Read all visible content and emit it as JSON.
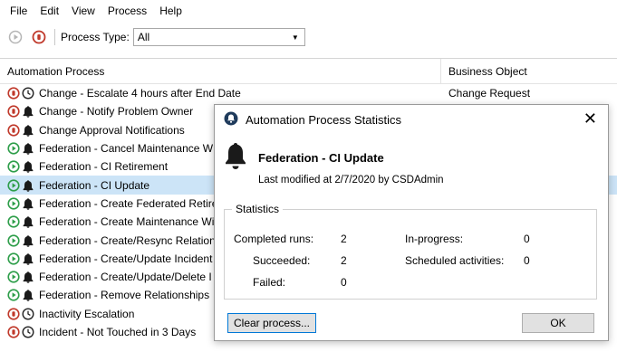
{
  "menu": [
    "File",
    "Edit",
    "View",
    "Process",
    "Help"
  ],
  "toolbar": {
    "process_type_label": "Process Type:",
    "process_type_value": "All"
  },
  "grid": {
    "columns": [
      "Automation Process",
      "Business Object"
    ],
    "rows": [
      {
        "status": "stop",
        "type": "clock",
        "name": "Change - Escalate 4 hours after End Date",
        "object": "Change Request"
      },
      {
        "status": "stop",
        "type": "bell",
        "name": "Change - Notify Problem Owner",
        "object": ""
      },
      {
        "status": "stop",
        "type": "bell",
        "name": "Change Approval Notifications",
        "object": ""
      },
      {
        "status": "play",
        "type": "bell",
        "name": "Federation - Cancel Maintenance W",
        "object": ""
      },
      {
        "status": "play",
        "type": "bell",
        "name": "Federation - CI Retirement",
        "object": ""
      },
      {
        "status": "play",
        "type": "bell",
        "name": "Federation - CI Update",
        "object": "",
        "selected": true
      },
      {
        "status": "play",
        "type": "bell",
        "name": "Federation - Create Federated Retire",
        "object": ""
      },
      {
        "status": "play",
        "type": "bell",
        "name": "Federation - Create Maintenance Wi",
        "object": ""
      },
      {
        "status": "play",
        "type": "bell",
        "name": "Federation - Create/Resync Relation",
        "object": ""
      },
      {
        "status": "play",
        "type": "bell",
        "name": "Federation - Create/Update Incident",
        "object": ""
      },
      {
        "status": "play",
        "type": "bell",
        "name": "Federation - Create/Update/Delete I",
        "object": ""
      },
      {
        "status": "play",
        "type": "bell",
        "name": "Federation - Remove Relationships",
        "object": ""
      },
      {
        "status": "stop",
        "type": "clock",
        "name": "Inactivity Escalation",
        "object": ""
      },
      {
        "status": "stop",
        "type": "clock",
        "name": "Incident -  Not Touched in 3 Days",
        "object": ""
      }
    ]
  },
  "dialog": {
    "title": "Automation Process Statistics",
    "process_name": "Federation - CI Update",
    "modified": "Last modified at 2/7/2020 by CSDAdmin",
    "group_label": "Statistics",
    "stats": {
      "completed_label": "Completed runs:",
      "completed_value": "2",
      "succeeded_label": "Succeeded:",
      "succeeded_value": "2",
      "failed_label": "Failed:",
      "failed_value": "0",
      "inprogress_label": "In-progress:",
      "inprogress_value": "0",
      "scheduled_label": "Scheduled activities:",
      "scheduled_value": "0"
    },
    "clear_button": "Clear process...",
    "ok_button": "OK",
    "close_glyph": "✕"
  },
  "colors": {
    "stop": "#c0392b",
    "play": "#2e9e4a",
    "selected_row": "#cce4f7",
    "accent": "#0078d7"
  }
}
